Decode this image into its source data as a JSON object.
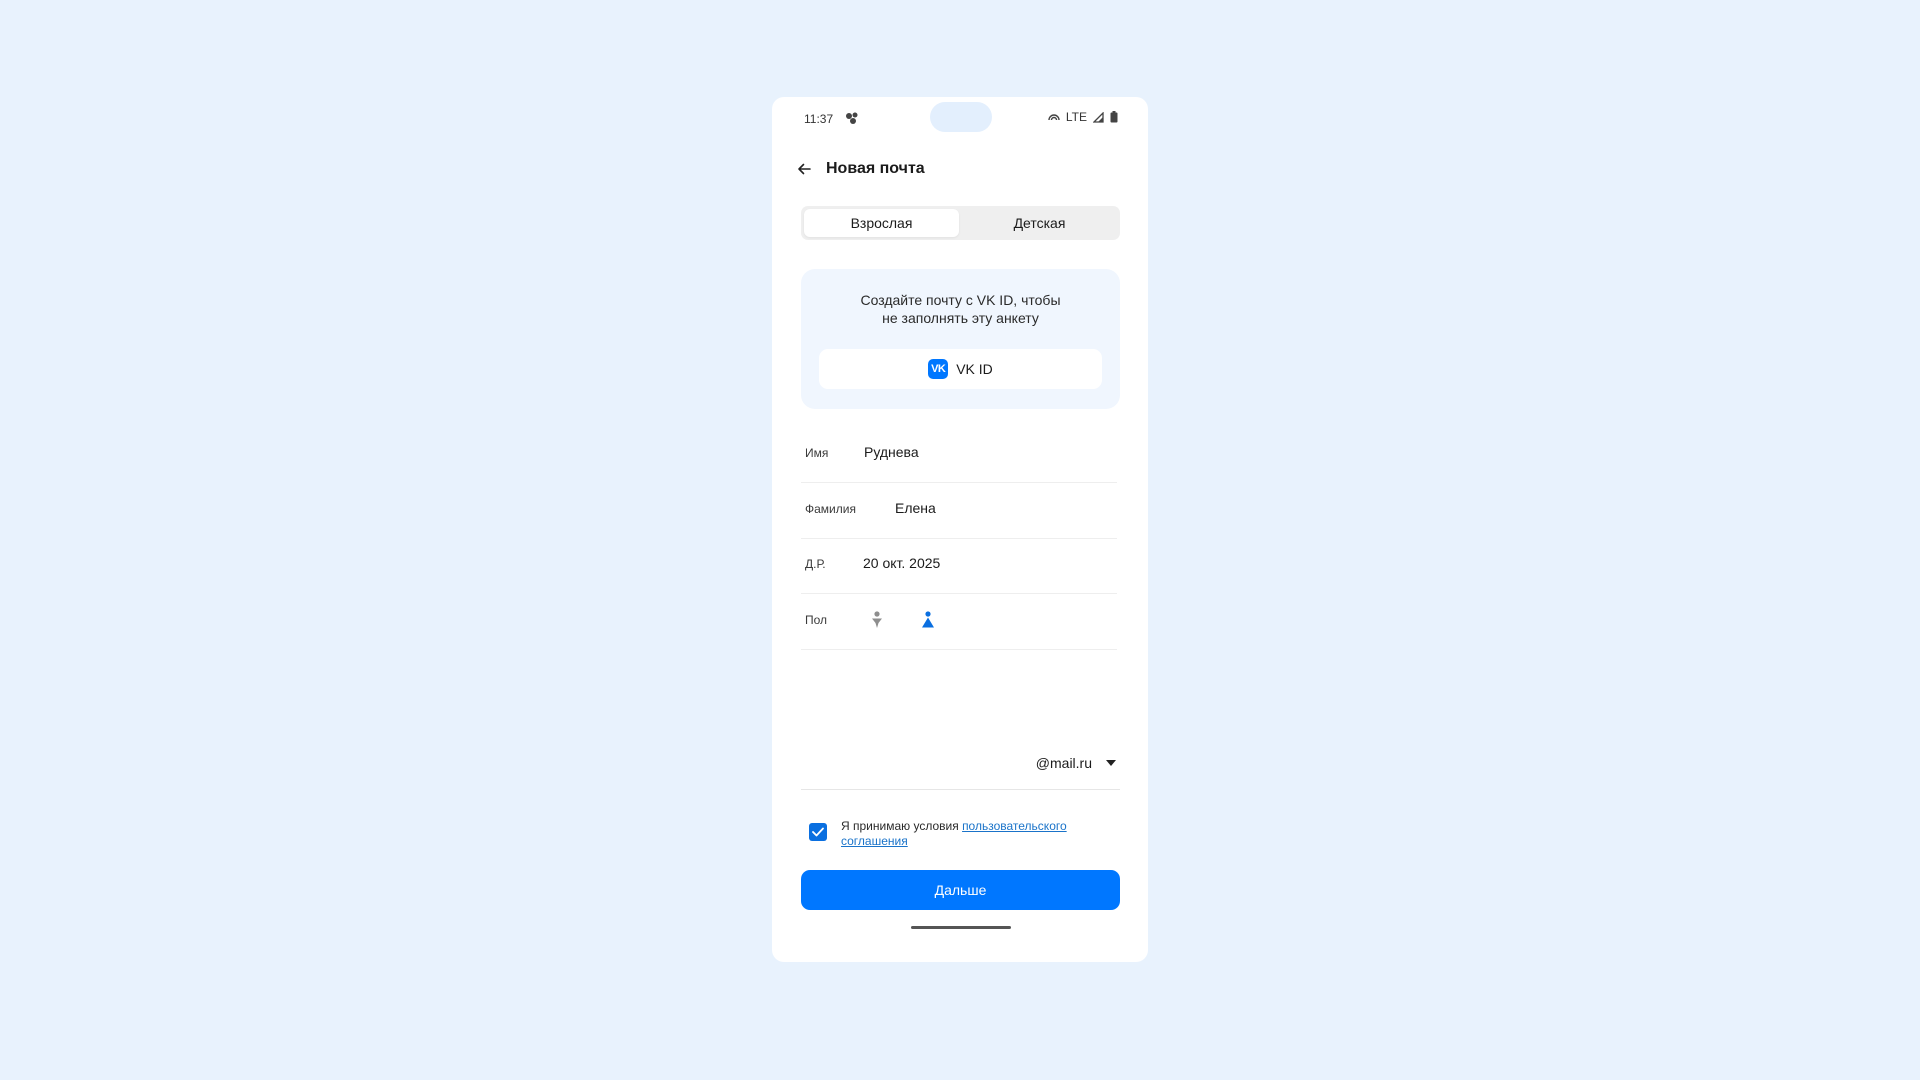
{
  "status_bar": {
    "time": "11:37",
    "network": "LTE"
  },
  "header": {
    "title": "Новая почта"
  },
  "tabs": [
    {
      "label": "Взрослая",
      "active": true
    },
    {
      "label": "Детская",
      "active": false
    }
  ],
  "vk_card": {
    "text_line1": "Создайте почту с VK ID, чтобы",
    "text_line2": "не заполнять эту анкету",
    "logo_text": "VK",
    "button_label": "VK ID"
  },
  "form": {
    "first_name": {
      "label": "Имя",
      "value": "Руднева"
    },
    "last_name": {
      "label": "Фамилия",
      "value": "Елена"
    },
    "birth_date": {
      "label": "Д.Р.",
      "value": "20 окт. 2025"
    },
    "gender": {
      "label": "Пол",
      "selected": "female"
    },
    "email": {
      "value": "",
      "domain": "@mail.ru"
    }
  },
  "agreement": {
    "checked": true,
    "text": "Я принимаю условия ",
    "link_text": "пользовательского соглашения"
  },
  "next_button": {
    "label": "Дальше"
  },
  "colors": {
    "page_background": "#e8f2fd",
    "accent": "#0077ff",
    "link": "#1a73c9",
    "gender_inactive": "#8e8e8e"
  }
}
